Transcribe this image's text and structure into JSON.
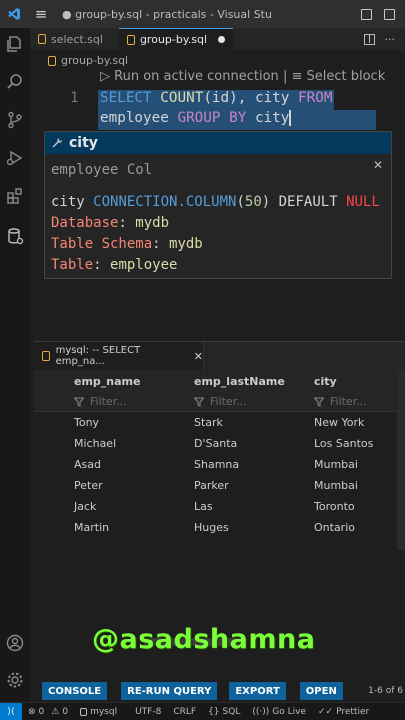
{
  "titlebar": {
    "title": "● group-by.sql - practicals - Visual Stu"
  },
  "tabs": [
    {
      "label": "select.sql"
    },
    {
      "label": "group-by.sql"
    }
  ],
  "breadcrumb": {
    "file": "group-by.sql"
  },
  "codelens": {
    "run": "▷ Run on active connection",
    "separator": "|",
    "select": "≡ Select block"
  },
  "editor": {
    "line_number": "1",
    "line1": [
      "SELECT",
      " ",
      "COUNT",
      "(id), city ",
      "FROM"
    ],
    "line2": [
      "employee ",
      "GROUP BY",
      " city"
    ]
  },
  "suggest": {
    "label": "city",
    "type": "employee Col",
    "doc": {
      "col_name": "city",
      "col_type": "CONNECTION.COLUMN",
      "col_len": "50",
      "col_default": "DEFAULT",
      "col_null": "NULL",
      "db_label": "Database",
      "db_value": "mydb",
      "schema_label": "Table Schema",
      "schema_value": "mydb",
      "table_label": "Table",
      "table_value": "employee"
    }
  },
  "results": {
    "tab_label": "mysql: -- SELECT emp_na...",
    "columns": [
      "emp_name",
      "emp_lastName",
      "city"
    ],
    "filter_placeholder": "Filter...",
    "rows": [
      [
        "Tony",
        "Stark",
        "New York"
      ],
      [
        "Michael",
        "D'Santa",
        "Los Santos"
      ],
      [
        "Asad",
        "Shamna",
        "Mumbai"
      ],
      [
        "Peter",
        "Parker",
        "Mumbai"
      ],
      [
        "Jack",
        "Las",
        "Toronto"
      ],
      [
        "Martin",
        "Huges",
        "Ontario"
      ]
    ],
    "buttons": {
      "console": "CONSOLE",
      "rerun": "RE-RUN QUERY",
      "export": "EXPORT",
      "open": "OPEN"
    },
    "pager": "1-6 of 6"
  },
  "watermark": "@asadshamna",
  "status": {
    "errors": "0",
    "warnings": "0",
    "connection": "mysql",
    "encoding": "UTF-8",
    "eol": "CRLF",
    "language": "SQL",
    "golive": "Go Live",
    "prettier": "Prettier"
  },
  "colors": {
    "accent": "#007acc",
    "selection": "#264f78",
    "watermark": "#7cff3a"
  }
}
